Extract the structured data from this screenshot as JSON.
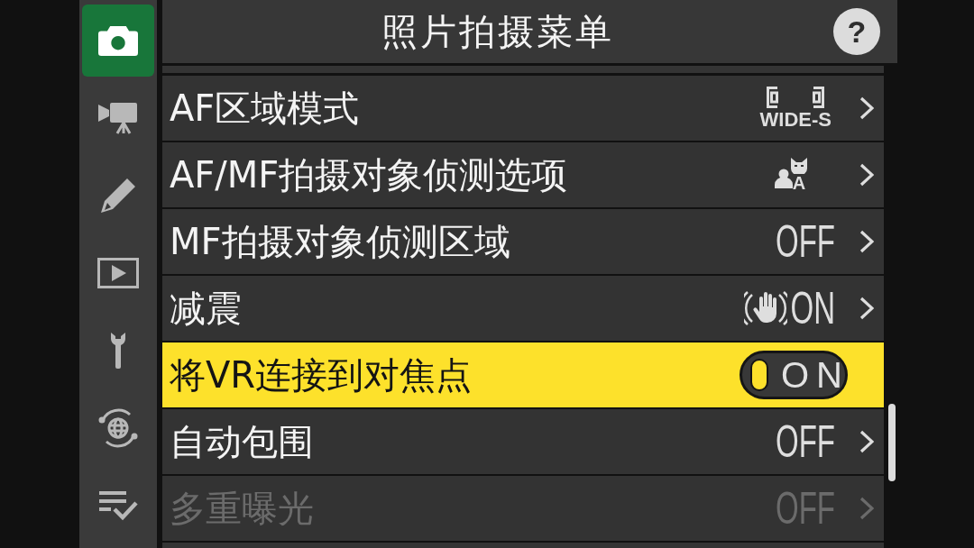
{
  "sidebar": {
    "items": [
      {
        "kind": "photo",
        "selected": true
      },
      {
        "kind": "movie",
        "selected": false
      },
      {
        "kind": "retouch",
        "selected": false
      },
      {
        "kind": "playback",
        "selected": false
      },
      {
        "kind": "setup",
        "selected": false
      },
      {
        "kind": "network",
        "selected": false
      },
      {
        "kind": "mymenu",
        "selected": false
      }
    ]
  },
  "header": {
    "title": "照片拍摄菜单",
    "help": "?"
  },
  "rows": [
    {
      "label": "AF区域模式",
      "value": {
        "kind": "area",
        "text": "WIDE-S"
      },
      "selected": false,
      "disabled": false
    },
    {
      "label": "AF/MF拍摄对象侦测选项",
      "value": {
        "kind": "subject",
        "text": "A"
      },
      "selected": false,
      "disabled": false
    },
    {
      "label": "MF拍摄对象侦测区域",
      "value": {
        "kind": "text",
        "text": "OFF"
      },
      "selected": false,
      "disabled": false
    },
    {
      "label": "减震",
      "value": {
        "kind": "vr",
        "text": "ON"
      },
      "selected": false,
      "disabled": false
    },
    {
      "label": "将VR连接到对焦点",
      "value": {
        "kind": "toggle",
        "text": "ON",
        "on": true
      },
      "selected": true,
      "disabled": false
    },
    {
      "label": "自动包围",
      "value": {
        "kind": "text",
        "text": "OFF"
      },
      "selected": false,
      "disabled": false
    },
    {
      "label": "多重曝光",
      "value": {
        "kind": "text",
        "text": "OFF"
      },
      "selected": false,
      "disabled": true
    }
  ]
}
